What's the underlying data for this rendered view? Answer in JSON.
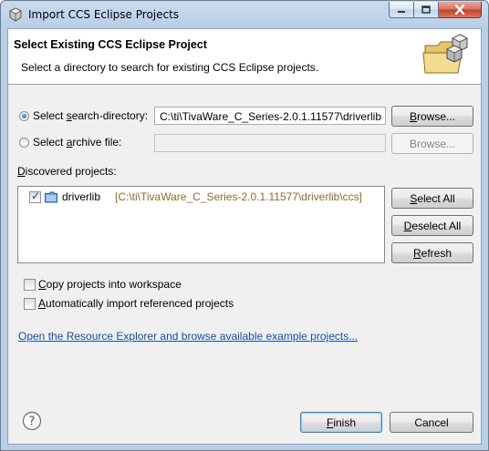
{
  "window": {
    "title": "Import CCS Eclipse Projects"
  },
  "banner": {
    "title": "Select Existing CCS Eclipse Project",
    "description": "Select a directory to search for existing CCS Eclipse projects."
  },
  "source": {
    "search_dir": {
      "label_pre": "Select ",
      "label_mn": "s",
      "label_post": "earch-directory:",
      "value": "C:\\ti\\TivaWare_C_Series-2.0.1.11577\\driverlib",
      "selected": true
    },
    "archive": {
      "label_pre": "Select ",
      "label_mn": "a",
      "label_post": "rchive file:",
      "value": "",
      "selected": false
    },
    "browse_mn": "B",
    "browse_rest": "rowse...",
    "browse_disabled_label": "Browse..."
  },
  "projects": {
    "label_mn": "D",
    "label_rest": "iscovered projects:",
    "items": [
      {
        "name": "driverlib",
        "path": "[C:\\ti\\TivaWare_C_Series-2.0.1.11577\\driverlib\\ccs]",
        "checked": true
      }
    ],
    "buttons": {
      "select_all_mn": "S",
      "select_all_rest": "elect All",
      "deselect_all_mn": "D",
      "deselect_all_rest": "eselect All",
      "refresh_mn": "R",
      "refresh_rest": "efresh"
    }
  },
  "options": {
    "copy": {
      "mn": "C",
      "rest": "opy projects into workspace",
      "checked": false
    },
    "auto_import": {
      "mn": "A",
      "rest": "utomatically import referenced projects",
      "checked": false
    }
  },
  "resource_link": "Open the Resource Explorer and browse available example projects...",
  "footer": {
    "finish_mn": "F",
    "finish_rest": "inish",
    "cancel": "Cancel"
  },
  "colors": {
    "link": "#1a4ea0",
    "project_path": "#8a6d28",
    "dialog_bg": "#f0f0f0"
  }
}
